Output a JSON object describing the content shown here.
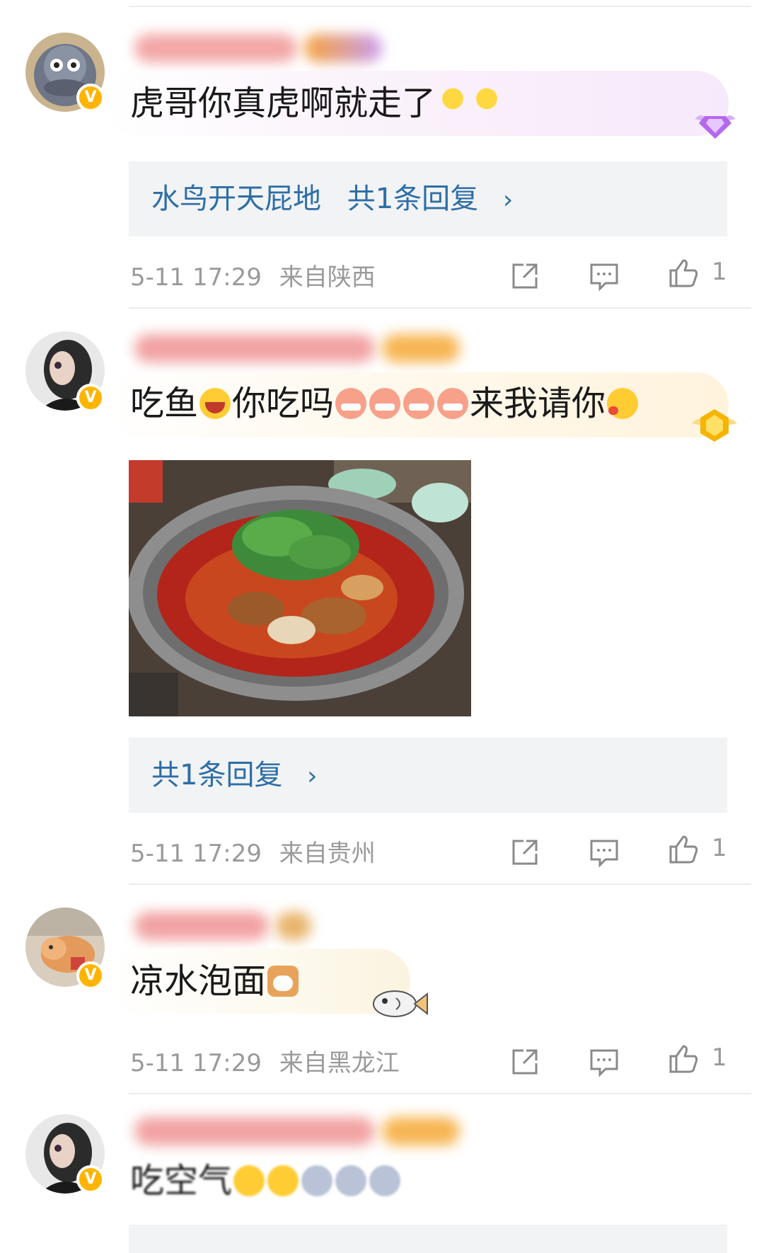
{
  "colors": {
    "link": "#2e6ea5",
    "meta": "#9a9a9a",
    "reply_bg": "#f1f3f5",
    "badge": "#ffb400"
  },
  "comments": [
    {
      "text": "虎哥你真虎啊就走了",
      "emojis": [
        "bulb-emoji",
        "bulb-emoji"
      ],
      "reply_author": "水鸟开天屁地",
      "reply_summary": "共1条回复",
      "time": "5-11 17:29",
      "location": "来自陕西",
      "likes": "1",
      "medal_icon": "purple-gem-medal-icon"
    },
    {
      "text_parts": [
        "吃鱼",
        "你吃吗",
        "来我请你"
      ],
      "reply_summary": "共1条回复",
      "time": "5-11 17:29",
      "location": "来自贵州",
      "likes": "1",
      "medal_icon": "gold-gem-medal-icon",
      "image": "spicy-fish-photo"
    },
    {
      "text": "凉水泡面",
      "time": "5-11 17:29",
      "location": "来自黑龙江",
      "likes": "1",
      "decoration_icon": "fish-sticker-icon"
    },
    {
      "text": "吃空气"
    }
  ],
  "icons": {
    "share": "share-icon",
    "comment": "comment-icon",
    "like": "thumbs-up-icon",
    "verified": "verified-badge-icon"
  },
  "verified_mark": "V",
  "chevron": "›"
}
